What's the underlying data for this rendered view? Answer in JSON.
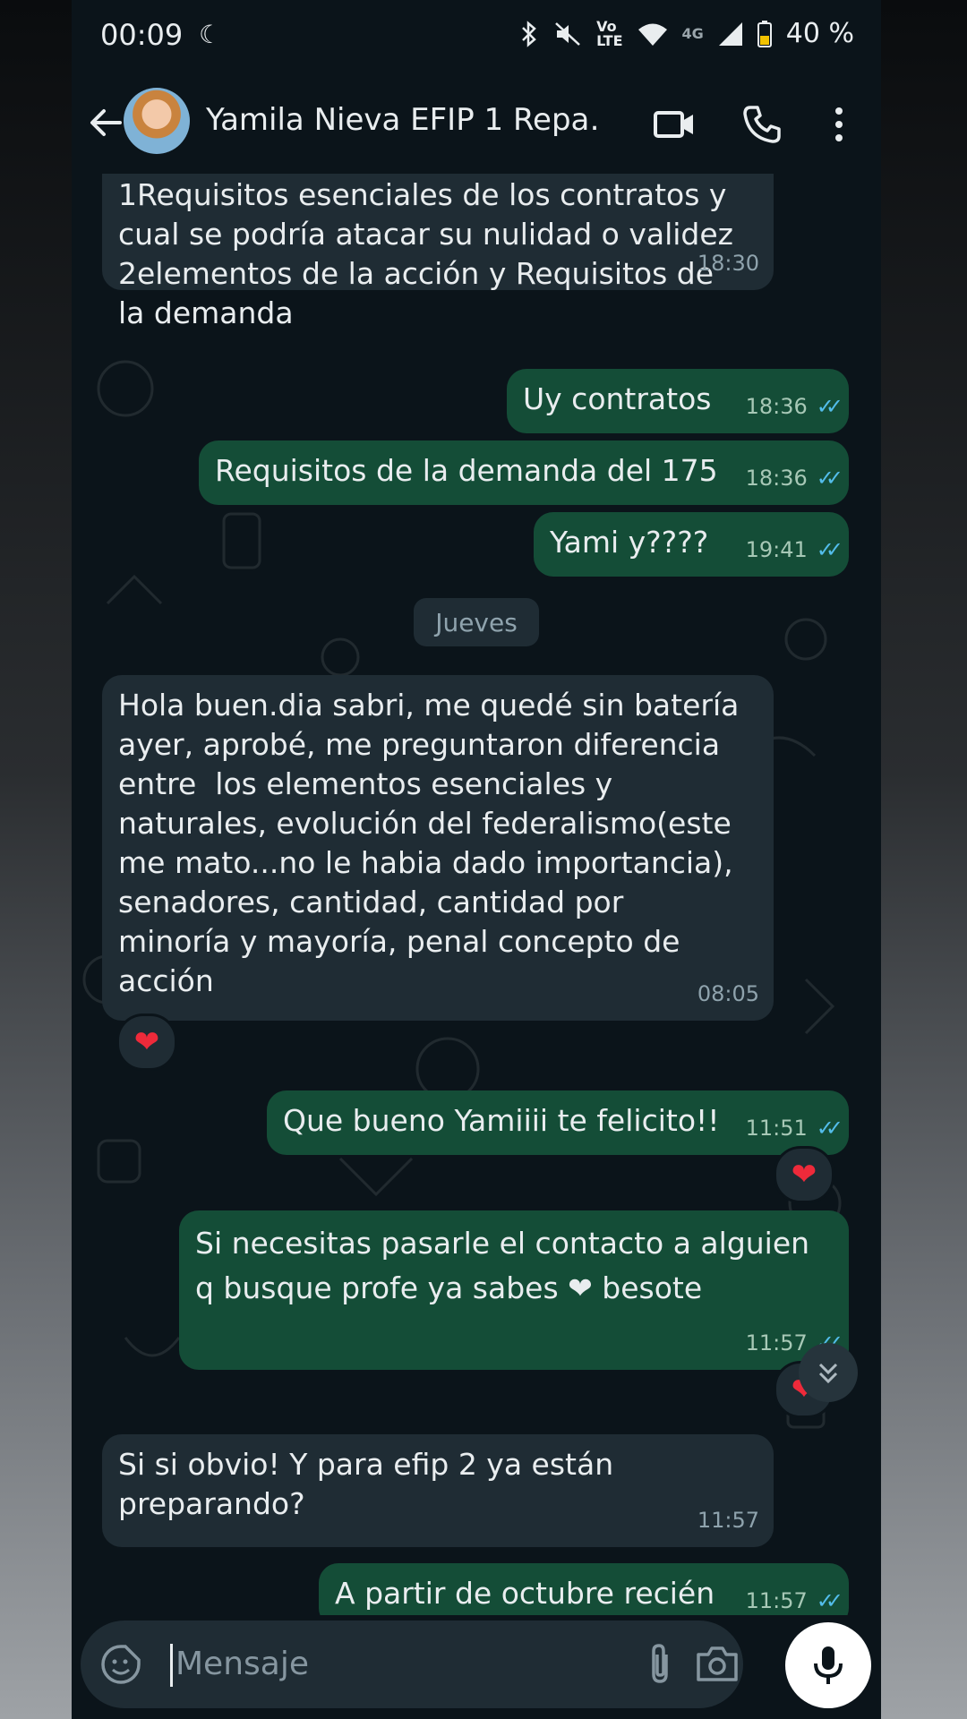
{
  "status_bar": {
    "time": "00:09",
    "moon_icon": "moon-icon",
    "volte_label": "Vo\nLTE",
    "network_label": "4G",
    "battery": "40 %"
  },
  "header": {
    "contact_name": "Yamila Nieva EFIP 1 Repa…"
  },
  "messages": [
    {
      "dir": "in",
      "text": "1Requisitos esenciales de los contratos y\ncual se podría atacar su nulidad o validez\n2elementos de la acción y Requisitos de\nla demanda",
      "time": "18:30"
    },
    {
      "dir": "out",
      "text": "Uy contratos",
      "time": "18:36"
    },
    {
      "dir": "out",
      "text": "Requisitos de la demanda del 175",
      "time": "18:36"
    },
    {
      "dir": "out",
      "text": "Yami y????",
      "time": "19:41"
    },
    {
      "dir": "in",
      "text": "Hola buen.dia sabri, me quedé sin batería\nayer, aprobé, me preguntaron diferencia\nentre  los elementos esenciales y\nnaturales, evolución del federalismo(este\nme mato...no le habia dado importancia),\nsenadores, cantidad, cantidad por\nminoría y mayoría, penal concepto de\nacción",
      "time": "08:05",
      "reaction": "❤"
    },
    {
      "dir": "out",
      "text": "Que bueno Yamiiii te felicito!!",
      "time": "11:51",
      "reaction": "❤"
    },
    {
      "dir": "out",
      "text": "Si necesitas pasarle el contacto a alguien\nq busque profe ya sabes ❤ besote",
      "time": "11:57",
      "reaction": "❤"
    },
    {
      "dir": "in",
      "text": "Si si obvio! Y para efip 2 ya están\npreparando?",
      "time": "11:57"
    },
    {
      "dir": "out",
      "text": "A partir de octubre recién",
      "time": "11:57"
    }
  ],
  "day_separator": "Jueves",
  "composer": {
    "placeholder": "Mensaje"
  },
  "colors": {
    "background": "#0b141a",
    "incoming_bubble": "#1f2c34",
    "outgoing_bubble": "#144d37",
    "read_ticks": "#53bdeb",
    "reaction_heart": "#ee2a3a"
  }
}
